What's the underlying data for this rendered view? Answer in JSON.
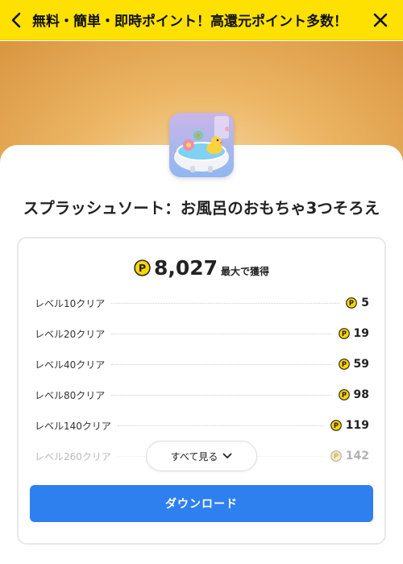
{
  "header": {
    "title": "無料・簡単・即時ポイント！高還元ポイント多数！",
    "back_icon": "chevron-left-icon",
    "close_icon": "close-icon"
  },
  "app": {
    "icon": "bathtub-rubber-duck-app-icon",
    "title": "スプラッシュソート：お風呂のおもちゃ3つそろえ"
  },
  "reward": {
    "coin_icon": "point-coin-icon",
    "coin_letter": "P",
    "total": "8,027",
    "total_suffix": "最大で獲得",
    "items": [
      {
        "label": "レベル10クリア",
        "points": "5"
      },
      {
        "label": "レベル20クリア",
        "points": "19"
      },
      {
        "label": "レベル40クリア",
        "points": "59"
      },
      {
        "label": "レベル80クリア",
        "points": "98"
      },
      {
        "label": "レベル140クリア",
        "points": "119"
      },
      {
        "label": "レベル260クリア",
        "points": "142"
      }
    ]
  },
  "see_all": {
    "label": "すべて見る",
    "icon": "chevron-down-icon"
  },
  "download": {
    "label": "ダウンロード"
  },
  "colors": {
    "header_bg": "#ffe100",
    "coin": "#ffd400",
    "button": "#2f80ef"
  }
}
